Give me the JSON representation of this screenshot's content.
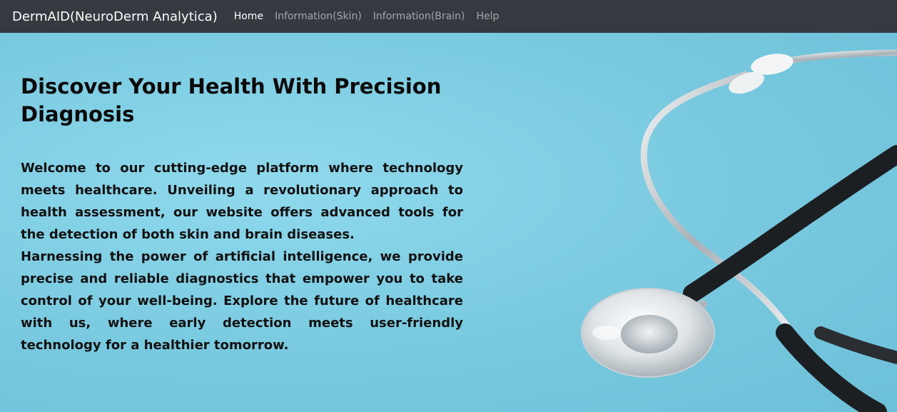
{
  "navbar": {
    "brand": "DermAID(NeuroDerm Analytica)",
    "links": [
      {
        "label": "Home",
        "active": true
      },
      {
        "label": "Information(Skin)",
        "active": false
      },
      {
        "label": "Information(Brain)",
        "active": false
      },
      {
        "label": "Help",
        "active": false
      }
    ]
  },
  "hero": {
    "headline": "Discover Your Health With Precision Diagnosis",
    "paragraphs": [
      "Welcome to our cutting-edge platform where technology meets healthcare. Unveiling a revolutionary approach to health assessment, our website offers advanced tools for the detection of both skin and brain diseases.",
      "Harnessing the power of artificial intelligence, we provide precise and reliable diagnostics that empower you to take control of your well-being. Explore the future of healthcare with us, where early detection meets user-friendly technology for a healthier tomorrow."
    ],
    "background_image": "stethoscope-image"
  },
  "colors": {
    "navbar_bg": "#343a40",
    "nav_active": "#ffffff",
    "nav_inactive": "#9a9da0",
    "hero_bg": "#7fd0e4",
    "text": "#111111"
  }
}
